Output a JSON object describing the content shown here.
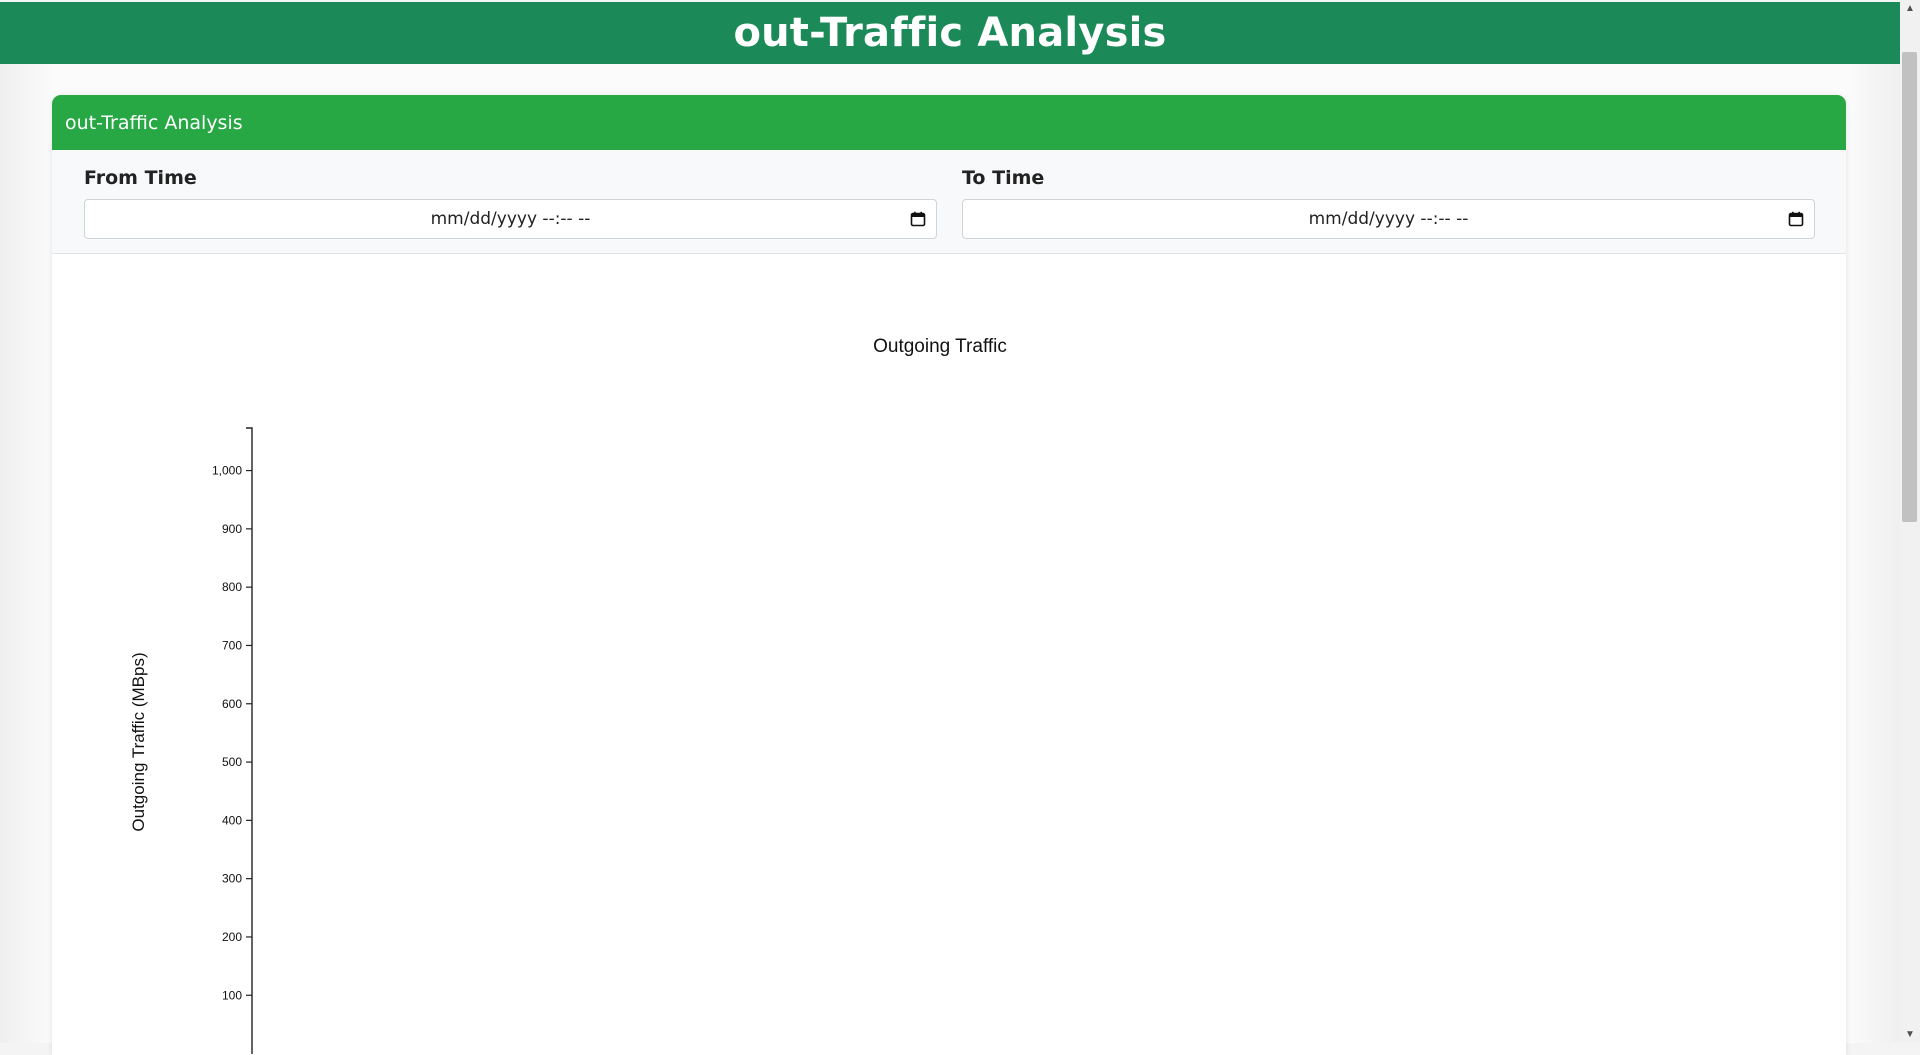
{
  "header": {
    "title": "out-Traffic Analysis"
  },
  "card": {
    "title": "out-Traffic Analysis"
  },
  "filters": {
    "from_label": "From Time",
    "from_value": "mm/dd/yyyy --:-- --",
    "to_label": "To Time",
    "to_value": "mm/dd/yyyy --:-- --"
  },
  "chart_data": {
    "type": "line",
    "title": "Outgoing Traffic",
    "xlabel": "",
    "ylabel": "Outgoing Traffic (MBps)",
    "y_ticks": [
      "100",
      "200",
      "300",
      "400",
      "500",
      "600",
      "700",
      "800",
      "900",
      "1,000"
    ],
    "y_tick_values": [
      100,
      200,
      300,
      400,
      500,
      600,
      700,
      800,
      900,
      1000
    ],
    "ylim": [
      0,
      1073
    ],
    "series": []
  }
}
